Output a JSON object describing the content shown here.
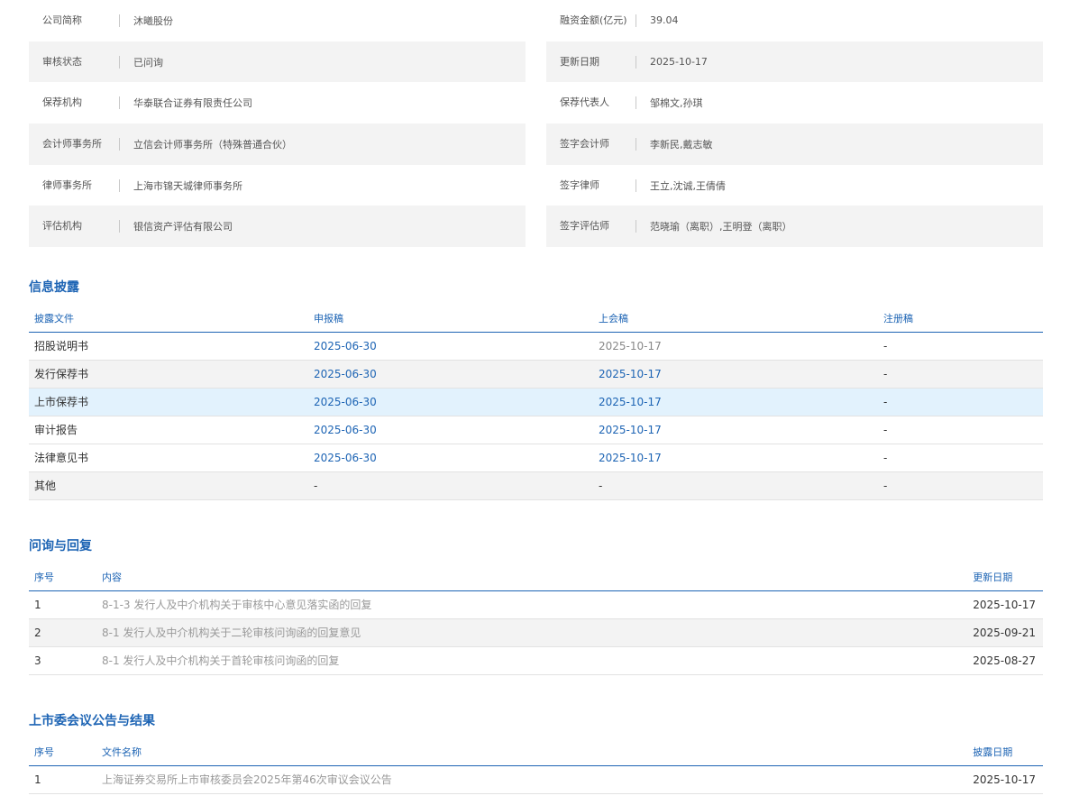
{
  "info": {
    "rows": [
      {
        "l1": "公司简称",
        "v1": "沐曦股份",
        "l2": "融资金额(亿元)",
        "v2": "39.04"
      },
      {
        "l1": "审核状态",
        "v1": "已问询",
        "l2": "更新日期",
        "v2": "2025-10-17"
      },
      {
        "l1": "保荐机构",
        "v1": "华泰联合证券有限责任公司",
        "l2": "保荐代表人",
        "v2": "邹棉文,孙琪"
      },
      {
        "l1": "会计师事务所",
        "v1": "立信会计师事务所（特殊普通合伙）",
        "l2": "签字会计师",
        "v2": "李新民,戴志敏"
      },
      {
        "l1": "律师事务所",
        "v1": "上海市锦天城律师事务所",
        "l2": "签字律师",
        "v2": "王立,沈诚,王倩倩"
      },
      {
        "l1": "评估机构",
        "v1": "银信资产评估有限公司",
        "l2": "签字评估师",
        "v2": "范晓瑜（离职）,王明登（离职）"
      }
    ]
  },
  "disclosure": {
    "title": "信息披露",
    "headers": [
      "披露文件",
      "申报稿",
      "上会稿",
      "注册稿"
    ],
    "rows": [
      {
        "doc": "招股说明书",
        "filing": "2025-06-30",
        "meeting": "2025-10-17",
        "reg": "-"
      },
      {
        "doc": "发行保荐书",
        "filing": "2025-06-30",
        "meeting": "2025-10-17",
        "reg": "-"
      },
      {
        "doc": "上市保荐书",
        "filing": "2025-06-30",
        "meeting": "2025-10-17",
        "reg": "-"
      },
      {
        "doc": "审计报告",
        "filing": "2025-06-30",
        "meeting": "2025-10-17",
        "reg": "-"
      },
      {
        "doc": "法律意见书",
        "filing": "2025-06-30",
        "meeting": "2025-10-17",
        "reg": "-"
      },
      {
        "doc": "其他",
        "filing": "-",
        "meeting": "-",
        "reg": "-"
      }
    ]
  },
  "inquiry": {
    "title": "问询与回复",
    "headers": [
      "序号",
      "内容",
      "更新日期"
    ],
    "rows": [
      {
        "no": "1",
        "content": "8-1-3 发行人及中介机构关于审核中心意见落实函的回复",
        "date": "2025-10-17"
      },
      {
        "no": "2",
        "content": "8-1 发行人及中介机构关于二轮审核问询函的回复意见",
        "date": "2025-09-21"
      },
      {
        "no": "3",
        "content": "8-1 发行人及中介机构关于首轮审核问询函的回复",
        "date": "2025-08-27"
      }
    ]
  },
  "committee": {
    "title": "上市委会议公告与结果",
    "headers": [
      "序号",
      "文件名称",
      "披露日期"
    ],
    "rows": [
      {
        "no": "1",
        "content": "上海证券交易所上市审核委员会2025年第46次审议会议公告",
        "date": "2025-10-17"
      }
    ]
  }
}
